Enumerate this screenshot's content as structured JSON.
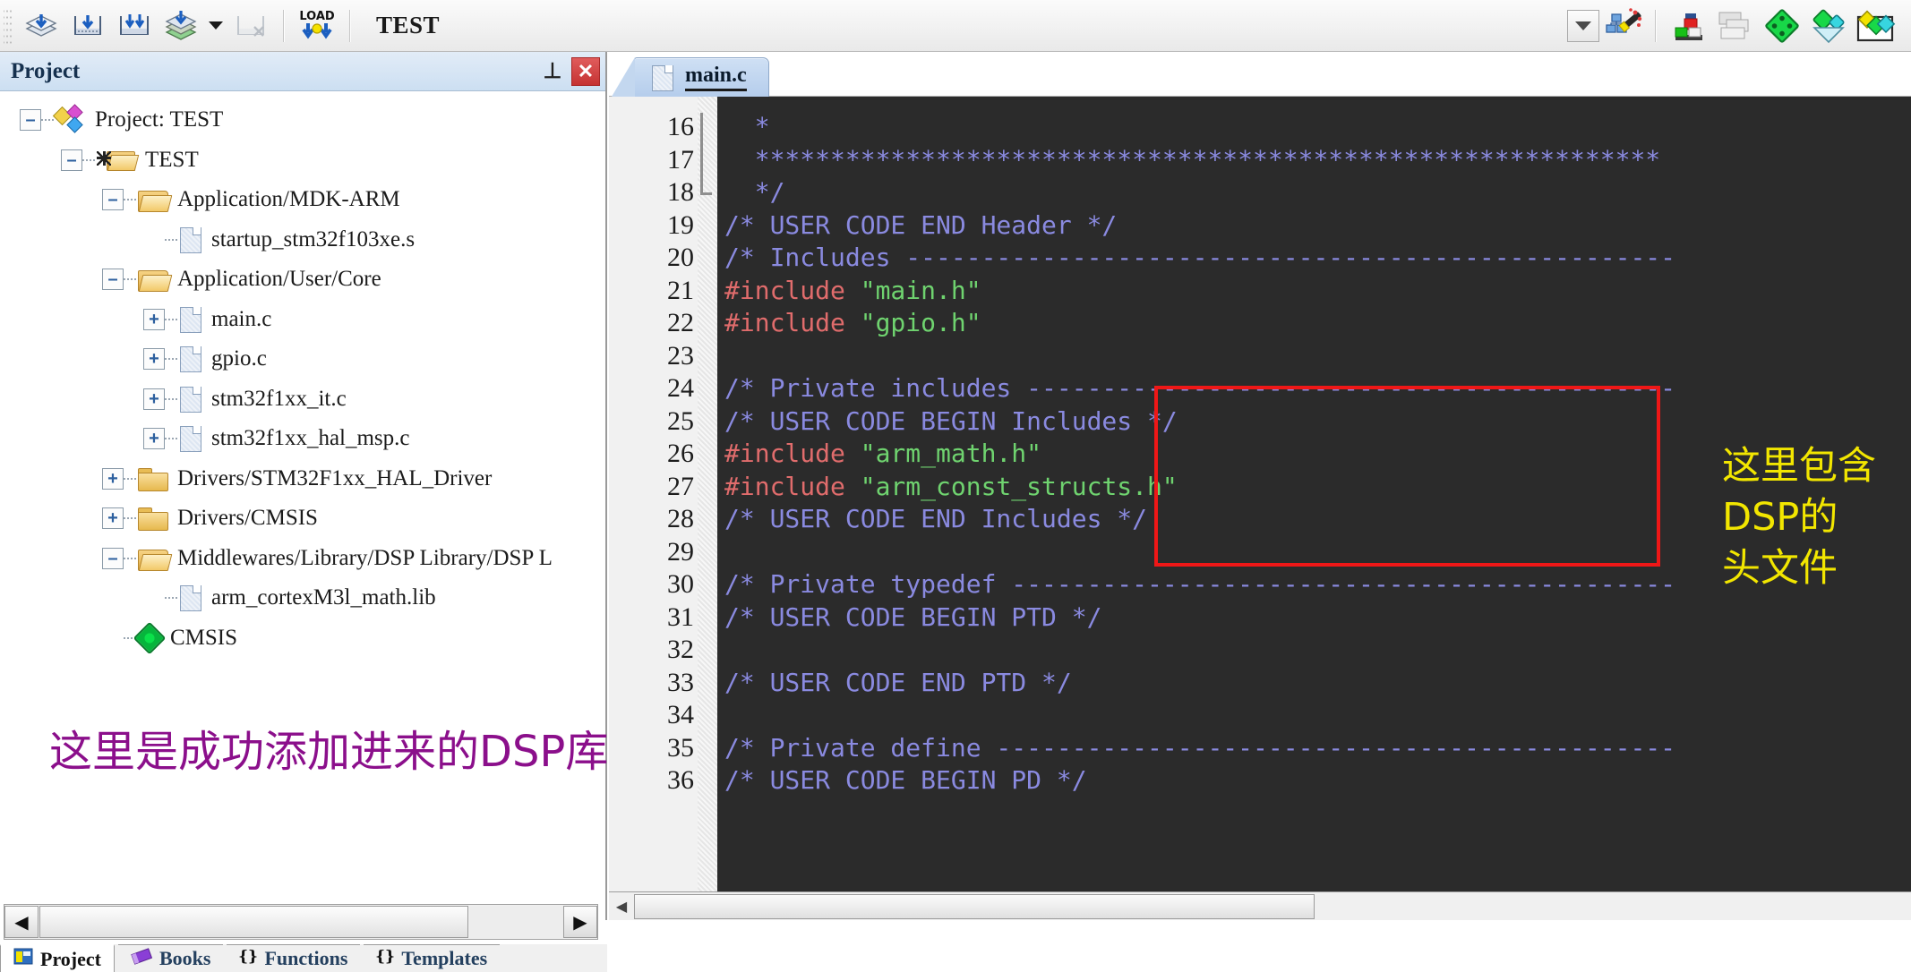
{
  "toolbar": {
    "title": "TEST",
    "buttons": [
      {
        "name": "translate-icon",
        "label": "Translate"
      },
      {
        "name": "build-icon",
        "label": "Build"
      },
      {
        "name": "rebuild-icon",
        "label": "Rebuild"
      },
      {
        "name": "batch-build-icon",
        "label": "Batch Build"
      },
      {
        "name": "stop-build-icon",
        "label": "Stop Build"
      },
      {
        "name": "download-icon",
        "label": "LOAD"
      },
      {
        "name": "configure-flash-tools-icon",
        "label": "Options for Target"
      },
      {
        "name": "manage-project-items-icon",
        "label": "Manage Project Items"
      },
      {
        "name": "manage-run-time-environment-icon",
        "label": "Manage Run-Time Environment"
      },
      {
        "name": "pack-installer-icon",
        "label": "Pack Installer"
      },
      {
        "name": "select-software-packs-icon",
        "label": "Select Software Packs"
      },
      {
        "name": "svcs-icon",
        "label": "Software Packs"
      }
    ],
    "target_select_value": ""
  },
  "project_panel": {
    "title": "Project",
    "pin_glyph": "⊥",
    "close_glyph": "✕",
    "tree": [
      {
        "label": "Project: TEST",
        "depth": 0,
        "expander": "minus",
        "icon": "project-icon"
      },
      {
        "label": "TEST",
        "depth": 1,
        "expander": "minus",
        "icon": "target-group-icon"
      },
      {
        "label": "Application/MDK-ARM",
        "depth": 2,
        "expander": "minus",
        "icon": "folder-open-icon"
      },
      {
        "label": "startup_stm32f103xe.s",
        "depth": 3,
        "expander": "none",
        "icon": "file-icon"
      },
      {
        "label": "Application/User/Core",
        "depth": 2,
        "expander": "minus",
        "icon": "folder-open-icon"
      },
      {
        "label": "main.c",
        "depth": 3,
        "expander": "plus",
        "icon": "file-icon"
      },
      {
        "label": "gpio.c",
        "depth": 3,
        "expander": "plus",
        "icon": "file-icon"
      },
      {
        "label": "stm32f1xx_it.c",
        "depth": 3,
        "expander": "plus",
        "icon": "file-icon"
      },
      {
        "label": "stm32f1xx_hal_msp.c",
        "depth": 3,
        "expander": "plus",
        "icon": "file-icon"
      },
      {
        "label": "Drivers/STM32F1xx_HAL_Driver",
        "depth": 2,
        "expander": "plus",
        "icon": "folder-closed-icon"
      },
      {
        "label": "Drivers/CMSIS",
        "depth": 2,
        "expander": "plus",
        "icon": "folder-closed-icon"
      },
      {
        "label": "Middlewares/Library/DSP Library/DSP L",
        "depth": 2,
        "expander": "minus",
        "icon": "folder-open-icon"
      },
      {
        "label": "arm_cortexM3l_math.lib",
        "depth": 3,
        "expander": "none",
        "icon": "file-icon"
      },
      {
        "label": "CMSIS",
        "depth": 2,
        "expander": "none",
        "icon": "cmsis-diamond-icon"
      }
    ],
    "annotation": "这里是成功添加进来的DSP库",
    "annotation_color": "#8b0f8b",
    "scrollbar": {
      "left_glyph": "◀",
      "right_glyph": "▶"
    }
  },
  "bottom_tabs": [
    {
      "label": "Project",
      "icon": "project-window-icon",
      "active": true
    },
    {
      "label": "Books",
      "icon": "books-icon",
      "active": false
    },
    {
      "label": "Functions",
      "icon": "functions-icon",
      "active": false
    },
    {
      "label": "Templates",
      "icon": "templates-icon",
      "active": false
    }
  ],
  "editor": {
    "tabs": [
      {
        "label": "main.c",
        "icon": "c-file-icon",
        "active": true
      }
    ],
    "first_line": 16,
    "lines": [
      {
        "n": 16,
        "segments": [
          {
            "t": "  *",
            "c": "cm"
          }
        ]
      },
      {
        "n": 17,
        "segments": [
          {
            "t": "  ************************************************************",
            "c": "cm"
          }
        ]
      },
      {
        "n": 18,
        "segments": [
          {
            "t": "  */",
            "c": "cm"
          }
        ]
      },
      {
        "n": 19,
        "segments": [
          {
            "t": "/* USER CODE END Header */",
            "c": "cm"
          }
        ]
      },
      {
        "n": 20,
        "segments": [
          {
            "t": "/* Includes ---------------------------------------------------",
            "c": "cm"
          }
        ]
      },
      {
        "n": 21,
        "segments": [
          {
            "t": "#include ",
            "c": "pp"
          },
          {
            "t": "\"main.h\"",
            "c": "st"
          }
        ]
      },
      {
        "n": 22,
        "segments": [
          {
            "t": "#include ",
            "c": "pp"
          },
          {
            "t": "\"gpio.h\"",
            "c": "st"
          }
        ]
      },
      {
        "n": 23,
        "segments": [
          {
            "t": "",
            "c": "cm"
          }
        ]
      },
      {
        "n": 24,
        "segments": [
          {
            "t": "/* Private includes -------------------------------------------",
            "c": "cm"
          }
        ]
      },
      {
        "n": 25,
        "segments": [
          {
            "t": "/* USER CODE BEGIN Includes */",
            "c": "cm"
          }
        ]
      },
      {
        "n": 26,
        "segments": [
          {
            "t": "#include ",
            "c": "pp"
          },
          {
            "t": "\"arm_math.h\"",
            "c": "st"
          }
        ]
      },
      {
        "n": 27,
        "segments": [
          {
            "t": "#include ",
            "c": "pp"
          },
          {
            "t": "\"arm_const_structs.h\"",
            "c": "st"
          }
        ]
      },
      {
        "n": 28,
        "segments": [
          {
            "t": "/* USER CODE END Includes */",
            "c": "cm"
          }
        ]
      },
      {
        "n": 29,
        "segments": [
          {
            "t": "",
            "c": "cm"
          }
        ]
      },
      {
        "n": 30,
        "segments": [
          {
            "t": "/* Private typedef --------------------------------------------",
            "c": "cm"
          }
        ]
      },
      {
        "n": 31,
        "segments": [
          {
            "t": "/* USER CODE BEGIN PTD */",
            "c": "cm"
          }
        ]
      },
      {
        "n": 32,
        "segments": [
          {
            "t": "",
            "c": "cm"
          }
        ]
      },
      {
        "n": 33,
        "segments": [
          {
            "t": "/* USER CODE END PTD */",
            "c": "cm"
          }
        ]
      },
      {
        "n": 34,
        "segments": [
          {
            "t": "",
            "c": "cm"
          }
        ]
      },
      {
        "n": 35,
        "segments": [
          {
            "t": "/* Private define ---------------------------------------------",
            "c": "cm"
          }
        ]
      },
      {
        "n": 36,
        "segments": [
          {
            "t": "/* USER CODE BEGIN PD */",
            "c": "cm"
          }
        ]
      }
    ],
    "annotation": "这里包含DSP的\n头文件",
    "annotation_color": "#f2e600",
    "highlight_box_color": "#ef1717",
    "background": "#2b2b2b",
    "comment_color": "#8a8ae0",
    "preprocessor_color": "#e06c6c",
    "string_color": "#6fd36f"
  }
}
